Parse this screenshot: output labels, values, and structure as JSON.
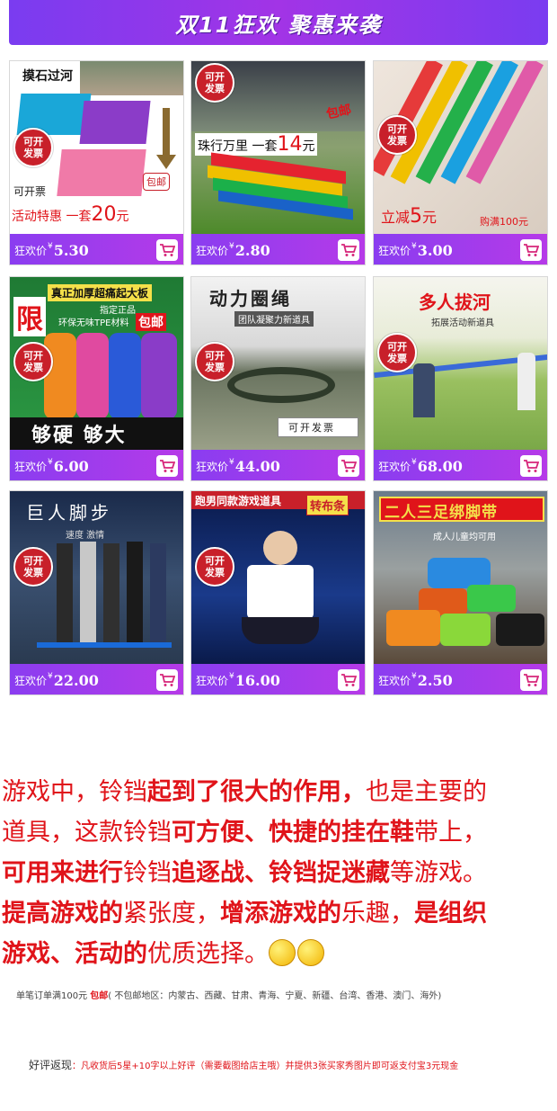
{
  "banner": {
    "title": "双11狂欢 聚惠来袭"
  },
  "price_label": "狂欢价",
  "currency": "¥",
  "invoice_badge": [
    "可开",
    "发票"
  ],
  "products": [
    {
      "price": "5.30",
      "texts": {
        "title": "摸石过河",
        "invoice": "可开票",
        "promo": "活动特惠 一套",
        "promo_num": "20",
        "promo_unit": "元",
        "tag": "包邮"
      }
    },
    {
      "price": "2.80",
      "texts": {
        "promo": "珠行万里 一套",
        "promo_num": "14",
        "promo_unit": "元",
        "tag": "包邮"
      }
    },
    {
      "price": "3.00",
      "texts": {
        "promo": "立减",
        "promo_num": "5",
        "promo_unit": "元",
        "sub": "购满100元"
      }
    },
    {
      "price": "6.00",
      "texts": {
        "t1": "限",
        "t2": "真正加厚超痛起大板",
        "t3": "指定正品",
        "t4": "环保无味TPE材料",
        "tag": "包邮",
        "t5": "够硬 够大"
      }
    },
    {
      "price": "44.00",
      "texts": {
        "title": "动力圈绳",
        "sub": "团队凝聚力新道具",
        "invoice": "可开发票"
      }
    },
    {
      "price": "68.00",
      "texts": {
        "title": "多人拔河",
        "sub": "拓展活动新道具"
      }
    },
    {
      "price": "22.00",
      "texts": {
        "title": "巨人脚步",
        "sub": "速度 激情"
      }
    },
    {
      "price": "16.00",
      "texts": {
        "title": "跑男同款游戏道具",
        "tag": "转布条"
      }
    },
    {
      "price": "2.50",
      "texts": {
        "title": "二人三足绑脚带",
        "sub": "成人儿童均可用"
      }
    }
  ],
  "description": {
    "line1": [
      "游戏中，铃铛",
      "起到了很大的作用，",
      "也是主要的"
    ],
    "line2": [
      "道具，这款铃铛",
      "可方便、快捷的挂在鞋",
      "带上，"
    ],
    "line3": [
      "可用来进行",
      "铃铛",
      "追逐战、铃铛",
      "捉迷藏",
      "等游戏。"
    ],
    "line4": [
      "提高游戏",
      "的",
      "紧张度，",
      "增添游戏",
      "的",
      "乐趣，",
      "是组织"
    ],
    "line5": [
      "游戏、活动",
      "的",
      "优质选择。"
    ]
  },
  "shipping": {
    "prefix": "单笔订单满100元 ",
    "highlight": "包邮",
    "suffix": "( 不包邮地区：内蒙古、西藏、甘肃、青海、宁夏、新疆、台湾、香港、澳门、海外)"
  },
  "review": {
    "label": "好评返现",
    "text": "：凡收货后5星+10字以上好评（需要截图给店主哦）并提供3张买家秀图片即可返支付宝3元现金"
  },
  "colors": {
    "accent": "#a234e6",
    "red": "#e0141a",
    "badge": "#c8202a",
    "cart": "#d6267a"
  }
}
